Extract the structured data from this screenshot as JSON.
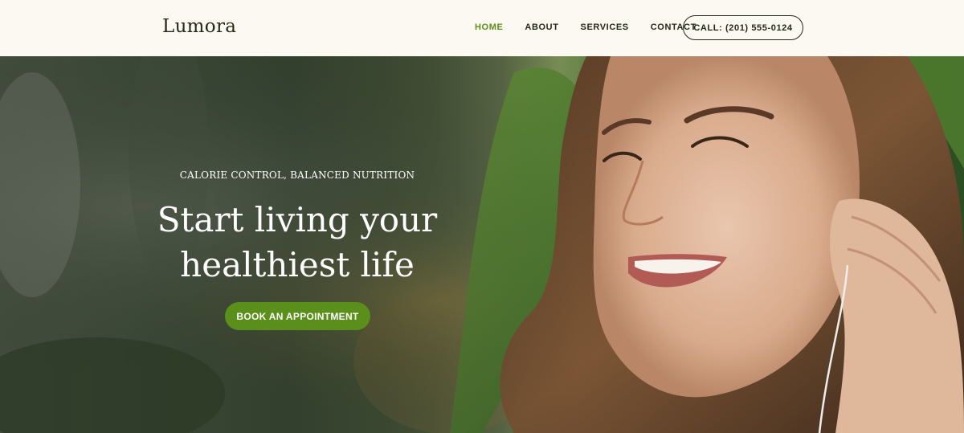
{
  "brand": {
    "logo_text": "Lumora"
  },
  "nav": {
    "items": [
      {
        "label": "HOME",
        "active": true
      },
      {
        "label": "ABOUT",
        "active": false
      },
      {
        "label": "SERVICES",
        "active": false
      },
      {
        "label": "CONTACT",
        "active": false
      }
    ],
    "call_label": "CALL: (201) 555-0124"
  },
  "hero": {
    "eyebrow": "CALORIE CONTROL, BALANCED NUTRITION",
    "headline_line1": "Start living your",
    "headline_line2": "healthiest life",
    "cta_label": "BOOK AN APPOINTMENT"
  },
  "colors": {
    "accent": "#5b8f1b",
    "text_dark": "#1f2a16",
    "header_bg": "#fcf9f2"
  }
}
